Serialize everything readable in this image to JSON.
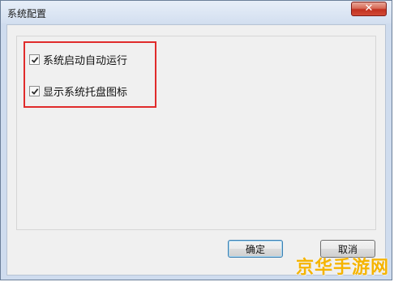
{
  "window": {
    "title": "系统配置",
    "close_symbol": "✕"
  },
  "options": [
    {
      "label": "系统启动自动运行",
      "checked": true
    },
    {
      "label": "显示系统托盘图标",
      "checked": true
    }
  ],
  "buttons": {
    "ok_label": "确定",
    "cancel_label": "取消"
  },
  "watermark": {
    "text": "京华手游网"
  },
  "colors": {
    "highlight_border": "#e02b2b",
    "watermark": "#f5b400",
    "close_button": "#c1311f"
  }
}
